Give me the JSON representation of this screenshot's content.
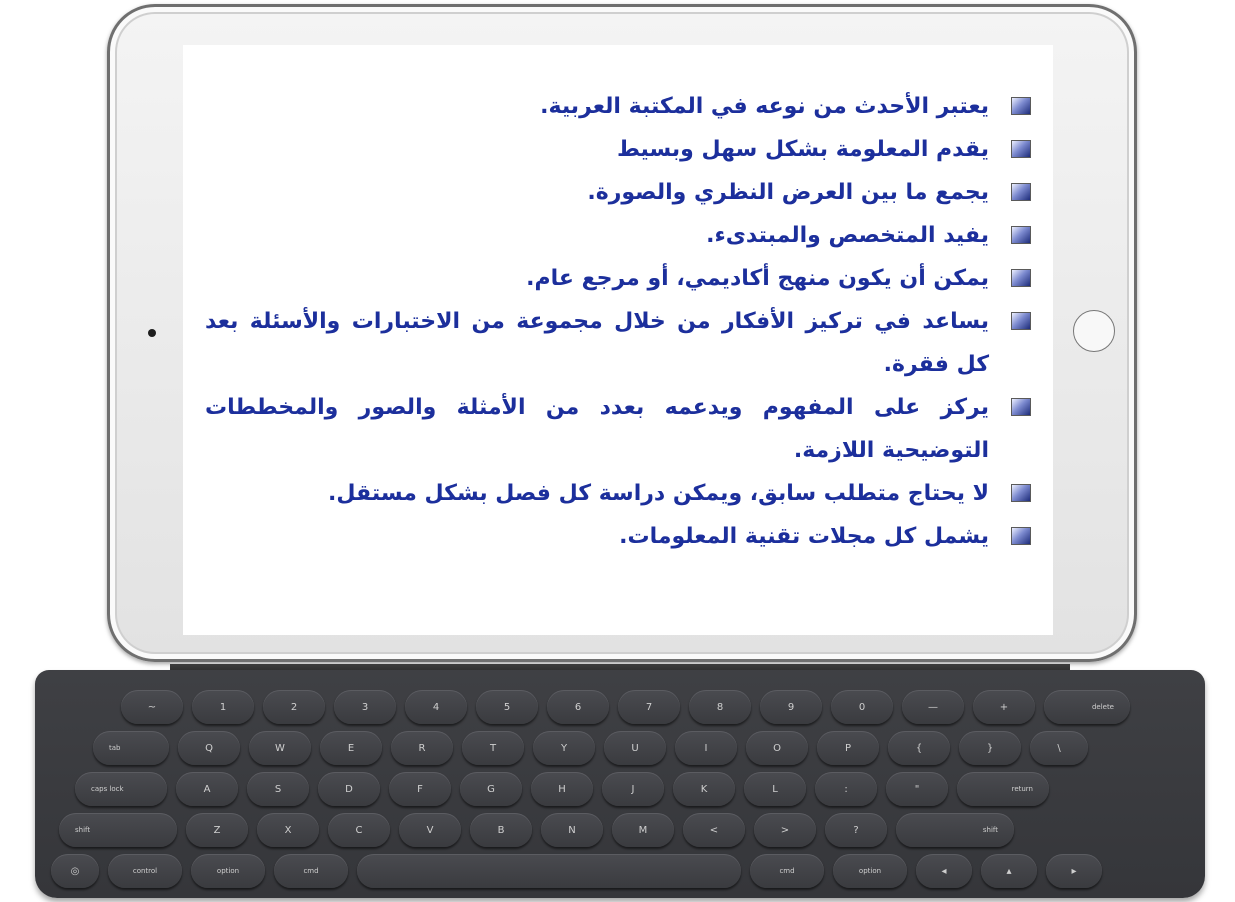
{
  "bullets": [
    "يعتبر الأحدث من نوعه في المكتبة العربية.",
    "يقدم المعلومة بشكل سهل وبسيط",
    "يجمع ما بين العرض النظري والصورة.",
    "يفيد المتخصص والمبتدىء.",
    "يمكن أن يكون منهج أكاديمي، أو مرجع عام.",
    "يساعد في تركيز الأفكار من خلال مجموعة من الاختبارات والأسئلة بعد كل فقرة.",
    "يركز على المفهوم ويدعمه بعدد من الأمثلة والصور والمخططات التوضيحية اللازمة.",
    "لا يحتاج متطلب سابق، ويمكن دراسة كل فصل بشكل مستقل.",
    "يشمل كل مجلات تقنية المعلومات."
  ],
  "keyboard": {
    "row1": [
      "~",
      "1",
      "2",
      "3",
      "4",
      "5",
      "6",
      "7",
      "8",
      "9",
      "0",
      "—",
      "+",
      "delete"
    ],
    "row2": [
      "tab",
      "Q",
      "W",
      "E",
      "R",
      "T",
      "Y",
      "U",
      "I",
      "O",
      "P",
      "{",
      "}",
      "\\"
    ],
    "row3": [
      "caps lock",
      "A",
      "S",
      "D",
      "F",
      "G",
      "H",
      "J",
      "K",
      "L",
      ":",
      "\"",
      "return"
    ],
    "row4": [
      "shift",
      "Z",
      "X",
      "C",
      "V",
      "B",
      "N",
      "M",
      "<",
      ">",
      "?",
      "shift"
    ],
    "row5": [
      "◎",
      "control",
      "option",
      "cmd",
      "",
      "cmd",
      "option",
      "◂",
      "▴",
      "▸"
    ]
  },
  "colors": {
    "text": "#1c2f9c",
    "keyboard": "#3a3b3f",
    "tablet_frame": "#e8e8e8"
  }
}
